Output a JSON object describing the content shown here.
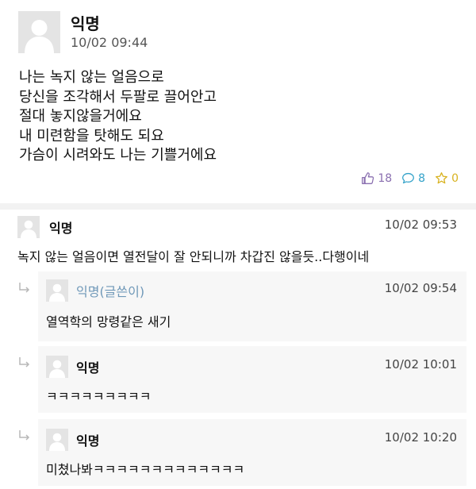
{
  "post": {
    "author": "익명",
    "time": "10/02 09:44",
    "lines": [
      "나는 녹지 않는 얼음으로",
      "당신을 조각해서 두팔로 끌어안고",
      "절대 놓지않을거에요",
      "내 미련함을 탓해도 되요",
      "가슴이 시려와도 나는 기쁠거에요"
    ],
    "likes": "18",
    "comments": "8",
    "scraps": "0"
  },
  "comments": [
    {
      "author": "익명",
      "time": "10/02 09:53",
      "text": "녹지 않는 얼음이면 열전달이 잘 안되니까 차갑진 않을듯..다행이네"
    }
  ],
  "replies": [
    {
      "author": "익명(글쓴이)",
      "time": "10/02 09:54",
      "text": "열역학의 망령같은 새기",
      "is_writer": true
    },
    {
      "author": "익명",
      "time": "10/02 10:01",
      "text": "ㅋㅋㅋㅋㅋㅋㅋㅋㅋ",
      "is_writer": false
    },
    {
      "author": "익명",
      "time": "10/02 10:20",
      "text": "미쳤나봐ㅋㅋㅋㅋㅋㅋㅋㅋㅋㅋㅋㅋㅋ",
      "is_writer": false
    }
  ],
  "colors": {
    "like": "#8a6fb0",
    "comment": "#33a2c9",
    "scrap": "#d8b21f",
    "writer": "#6f98b8",
    "reply_bg": "#f7f7f7"
  },
  "icons": {
    "avatar": "default-avatar-icon",
    "like": "thumbs-up-icon",
    "comment": "speech-bubble-icon",
    "scrap": "star-icon",
    "reply": "reply-arrow-icon"
  }
}
